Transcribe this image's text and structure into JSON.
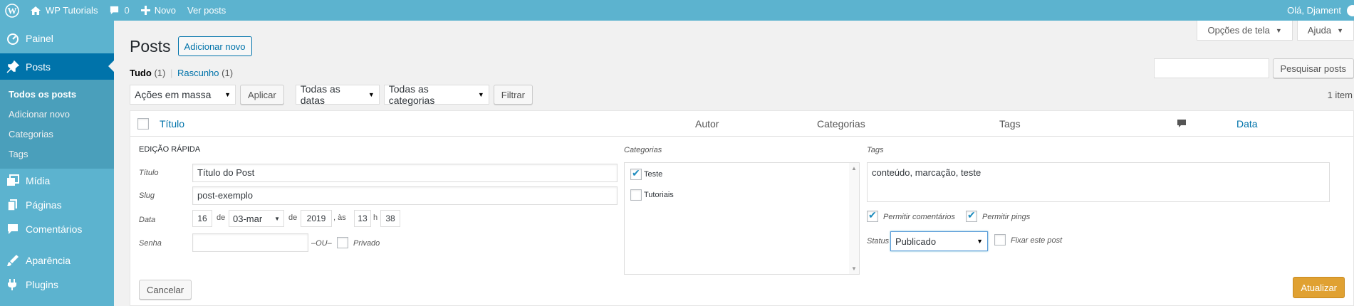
{
  "adminbar": {
    "site_name": "WP Tutorials",
    "comments_count": "0",
    "new_label": "Novo",
    "view_posts": "Ver posts",
    "greeting": "Olá, Djament"
  },
  "sidebar": {
    "items": [
      {
        "label": "Painel",
        "icon": "dashboard-icon"
      },
      {
        "label": "Posts",
        "icon": "pin-icon"
      },
      {
        "label": "Mídia",
        "icon": "media-icon"
      },
      {
        "label": "Páginas",
        "icon": "pages-icon"
      },
      {
        "label": "Comentários",
        "icon": "comments-icon"
      },
      {
        "label": "Aparência",
        "icon": "appearance-icon"
      },
      {
        "label": "Plugins",
        "icon": "plugins-icon"
      }
    ],
    "submenu": [
      "Todos os posts",
      "Adicionar novo",
      "Categorias",
      "Tags"
    ]
  },
  "screen_meta": {
    "options": "Opções de tela",
    "help": "Ajuda"
  },
  "page": {
    "title": "Posts",
    "add_new": "Adicionar novo",
    "filter_all": "Tudo",
    "filter_all_count": "(1)",
    "filter_sep": "|",
    "filter_draft": "Rascunho",
    "filter_draft_count": "(1)",
    "search_button": "Pesquisar posts",
    "bulk_actions": "Ações em massa",
    "apply": "Aplicar",
    "all_dates": "Todas as datas",
    "all_categories": "Todas as categorias",
    "filter": "Filtrar",
    "items_count": "1 item"
  },
  "table": {
    "columns": {
      "title": "Título",
      "author": "Autor",
      "categories": "Categorias",
      "tags": "Tags",
      "date": "Data"
    }
  },
  "quick_edit": {
    "heading": "Edição rápida",
    "title_label": "Título",
    "title_value": "Título do Post",
    "slug_label": "Slug",
    "slug_value": "post-exemplo",
    "date_label": "Data",
    "day": "16",
    "de1": "de",
    "month": "03-mar",
    "de2": "de",
    "year": "2019",
    "as": ", às",
    "hour": "13",
    "h": "h",
    "minute": "38",
    "password_label": "Senha",
    "or": "–OU–",
    "private_label": "Privado",
    "categories_label": "Categorias",
    "cat_teste": "Teste",
    "cat_tutoriais": "Tutoriais",
    "tags_label": "Tags",
    "tags_value": "conteúdo, marcação, teste",
    "allow_comments": "Permitir comentários",
    "allow_pings": "Permitir pings",
    "status_label": "Status",
    "status_value": "Publicado",
    "sticky_label": "Fixar este post",
    "cancel": "Cancelar",
    "update": "Atualizar"
  },
  "colors": {
    "sidebar": "#5cb3cf",
    "current": "#0073aa",
    "primary": "#e0a132"
  }
}
